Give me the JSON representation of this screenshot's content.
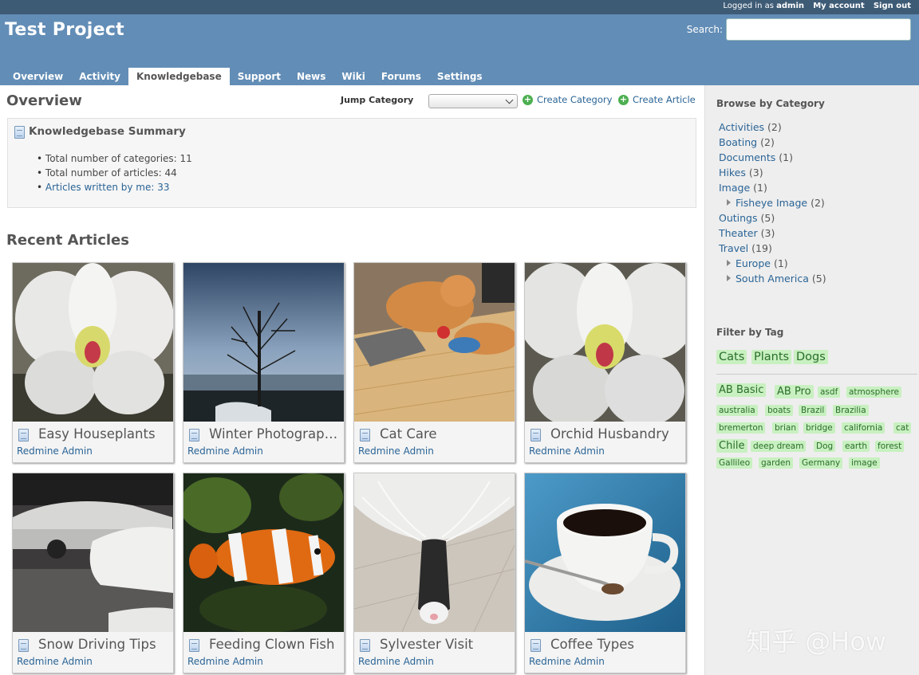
{
  "top_menu": {
    "logged_in_prefix": "Logged in as",
    "user": "admin",
    "my_account": "My account",
    "sign_out": "Sign out"
  },
  "header": {
    "title": "Test Project",
    "search_label": "Search:"
  },
  "main_menu": [
    "Overview",
    "Activity",
    "Knowledgebase",
    "Support",
    "News",
    "Wiki",
    "Forums",
    "Settings"
  ],
  "selected_tab": "Knowledgebase",
  "overview": {
    "title": "Overview",
    "jump_label": "Jump Category",
    "create_category": "Create Category",
    "create_article": "Create Article"
  },
  "summary": {
    "title": "Knowledgebase Summary",
    "total_categories": "Total number of categories: 11",
    "total_articles": "Total number of articles: 44",
    "written_by_me": "Articles written by me: 33"
  },
  "recent": {
    "title": "Recent Articles",
    "articles": [
      {
        "title": "Easy Houseplants",
        "author": "Redmine Admin"
      },
      {
        "title": "Winter Photography",
        "author": "Redmine Admin"
      },
      {
        "title": "Cat Care",
        "author": "Redmine Admin"
      },
      {
        "title": "Orchid Husbandry",
        "author": "Redmine Admin"
      },
      {
        "title": "Snow Driving Tips",
        "author": "Redmine Admin"
      },
      {
        "title": "Feeding Clown Fish",
        "author": "Redmine Admin"
      },
      {
        "title": "Sylvester Visit",
        "author": "Redmine Admin"
      },
      {
        "title": "Coffee Types",
        "author": "Redmine Admin"
      }
    ]
  },
  "sidebar": {
    "browse_title": "Browse by Category",
    "categories": [
      {
        "name": "Activities",
        "count": "(2)"
      },
      {
        "name": "Boating",
        "count": "(2)"
      },
      {
        "name": "Documents",
        "count": "(1)"
      },
      {
        "name": "Hikes",
        "count": "(3)"
      },
      {
        "name": "Image",
        "count": "(1)"
      },
      {
        "name": "Fisheye Image",
        "count": "(2)"
      },
      {
        "name": "Outings",
        "count": "(5)"
      },
      {
        "name": "Theater",
        "count": "(3)"
      },
      {
        "name": "Travel",
        "count": "(19)"
      },
      {
        "name": "Europe",
        "count": "(1)"
      },
      {
        "name": "South America",
        "count": "(5)"
      }
    ],
    "filter_title": "Filter by Tag",
    "top_tags": [
      "Cats",
      "Plants",
      "Dogs"
    ],
    "tags": [
      "AB Basic",
      "AB Pro",
      "asdf",
      "atmosphere",
      "australia",
      "boats",
      "Brazil",
      "Brazilia",
      "bremerton",
      "brian",
      "bridge",
      "california",
      "cat",
      "Chile",
      "deep dream",
      "Dog",
      "earth",
      "forest",
      "Gallileo",
      "garden",
      "Germany",
      "image"
    ]
  },
  "watermark": "知乎 @How",
  "colors": {
    "header": "#628db6",
    "top_menu": "#3e5b76",
    "link": "#2a6496",
    "tag_bg": "#c8f0c0"
  }
}
